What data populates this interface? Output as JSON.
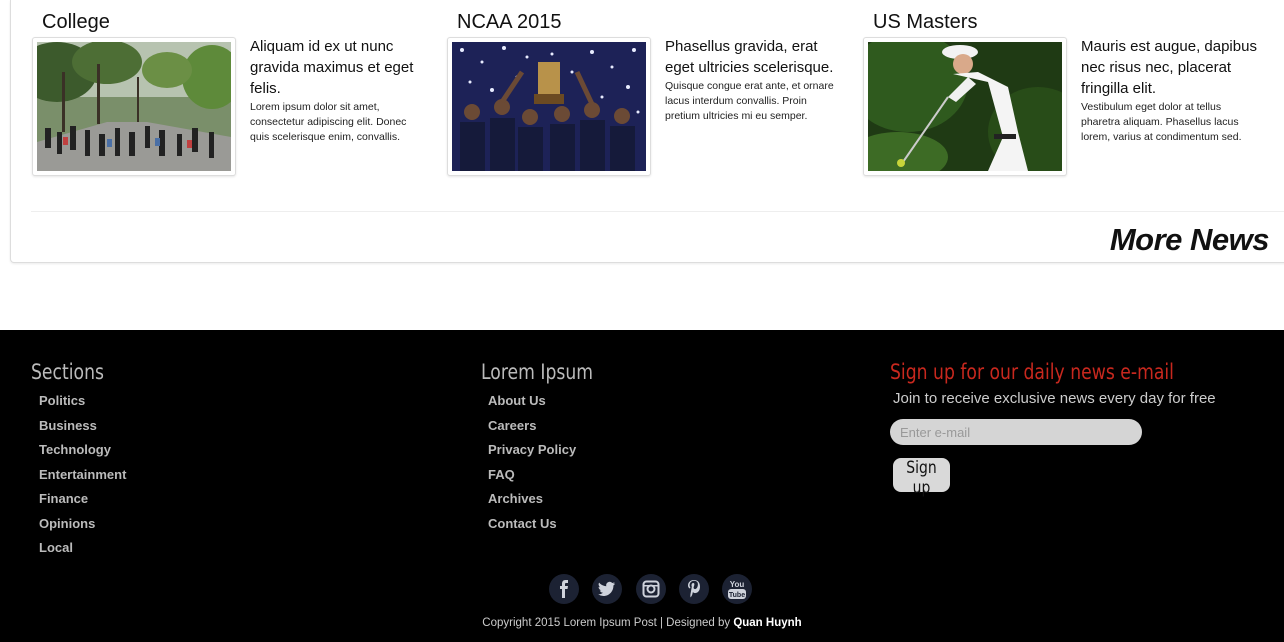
{
  "stories": [
    {
      "title": "College",
      "headline": "Aliquam id ex ut nunc gravida maximus et eget felis.",
      "summary": "Lorem ipsum dolor sit amet, consectetur adipiscing elit. Donec quis scelerisque enim, convallis."
    },
    {
      "title": "NCAA 2015",
      "headline": "Phasellus gravida, erat eget ultricies scelerisque.",
      "summary": "Quisque congue erat ante, et ornare lacus interdum convallis. Proin pretium ultricies mi eu semper."
    },
    {
      "title": "US Masters",
      "headline": "Mauris est augue, dapibus nec risus nec, placerat fringilla elit.",
      "summary": "Vestibulum eget dolor at tellus pharetra aliquam. Phasellus lacus lorem, varius at condimentum sed."
    }
  ],
  "more_news": "More News",
  "footer": {
    "sections": {
      "title": "Sections",
      "links": [
        "Politics",
        "Business",
        "Technology",
        "Entertainment",
        "Finance",
        "Opinions",
        "Local"
      ]
    },
    "company": {
      "title": "Lorem Ipsum",
      "links": [
        "About Us",
        "Careers",
        "Privacy Policy",
        "FAQ",
        "Archives",
        "Contact Us"
      ]
    },
    "newsletter": {
      "title": "Sign up for our daily news e-mail",
      "subtitle": "Join to receive exclusive news every day for free",
      "placeholder": "Enter e-mail",
      "button": "Sign up"
    },
    "social_icons": [
      "facebook-icon",
      "twitter-icon",
      "instagram-icon",
      "pinterest-icon",
      "youtube-icon"
    ],
    "copyright": "Copyright 2015 Lorem Ipsum Post | Designed by",
    "designer": "Quan Huynh"
  },
  "colors": {
    "footer_bg": "#000000",
    "newsletter_title": "#c8281e",
    "social_bg": "#1c2233"
  }
}
